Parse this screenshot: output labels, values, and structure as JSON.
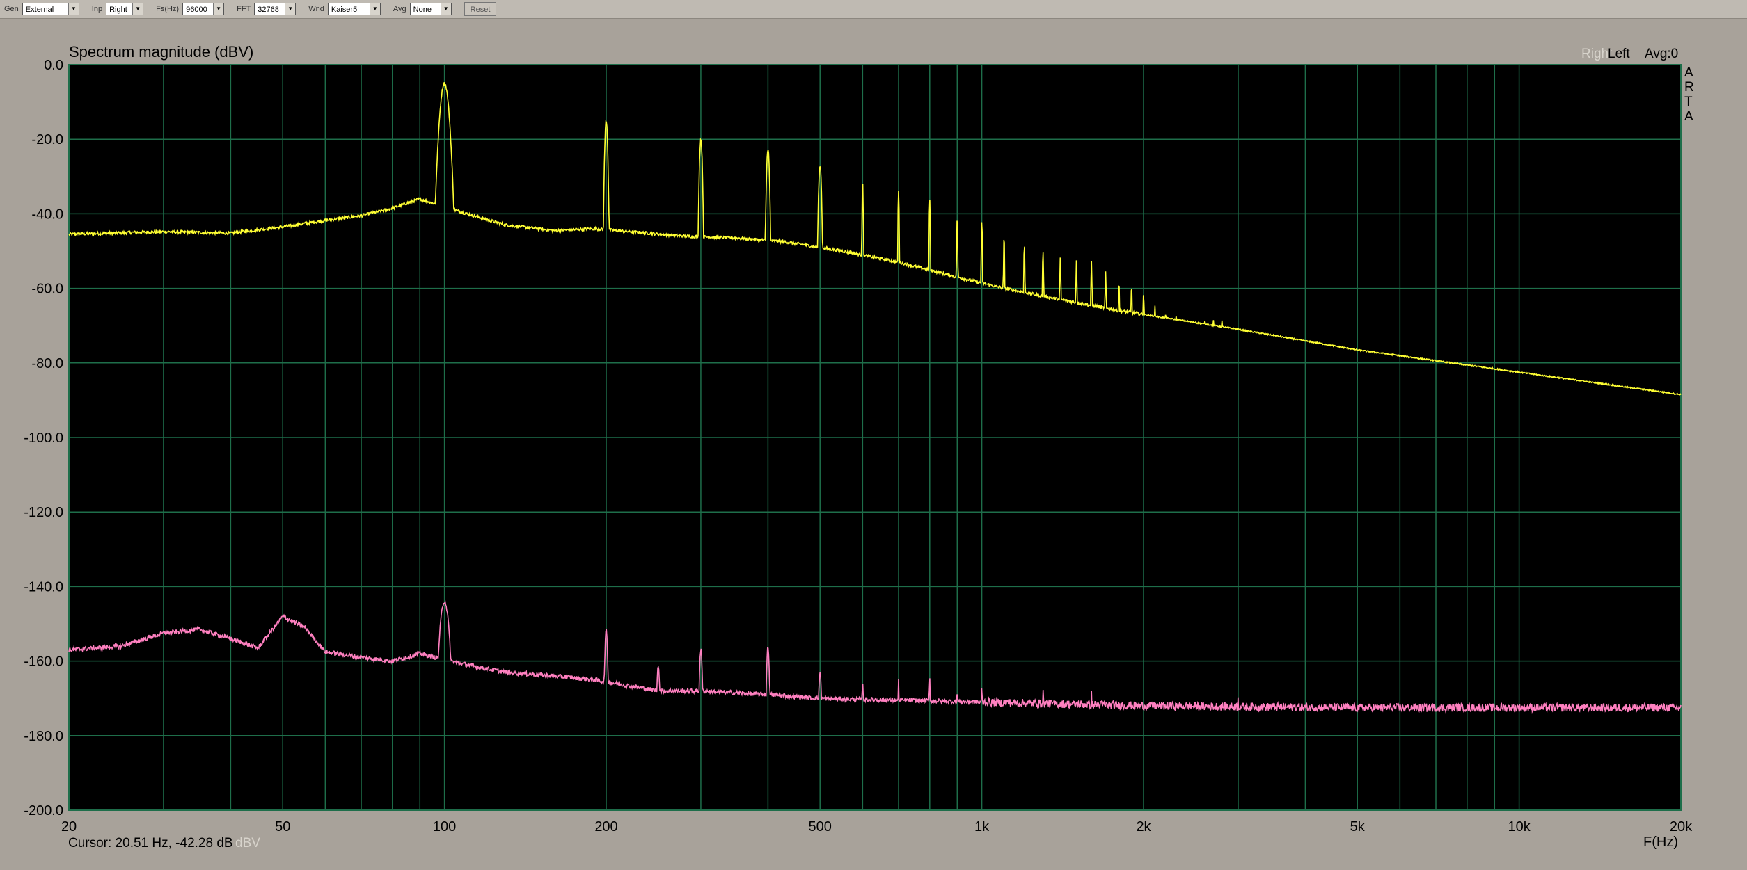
{
  "toolbar": {
    "gen_label": "Gen",
    "gen_value": "External",
    "inp_label": "Inp",
    "inp_value": "Right",
    "fs_label": "Fs(Hz)",
    "fs_value": "96000",
    "fft_label": "FFT",
    "fft_value": "32768",
    "wnd_label": "Wnd",
    "wnd_value": "Kaiser5",
    "avg_label": "Avg",
    "avg_value": "None",
    "reset_label": "Reset"
  },
  "status": {
    "channel_text": "Left",
    "avg_text": "Avg:0",
    "faded_text": "Right",
    "cursor_text": "Cursor: 20.51 Hz, -42.28 dB",
    "cursor_faded": "dBV",
    "arta_letters": [
      "A",
      "R",
      "T",
      "A"
    ]
  },
  "chart_data": {
    "type": "line",
    "title": "Spectrum magnitude (dBV)",
    "xlabel": "F(Hz)",
    "ylabel": "",
    "xscale": "log",
    "xlim": [
      20,
      20000
    ],
    "ylim": [
      -200,
      0
    ],
    "grid": true,
    "y_ticks": [
      0,
      -20,
      -40,
      -60,
      -80,
      -100,
      -120,
      -140,
      -160,
      -180,
      -200
    ],
    "y_tick_labels": [
      "0.0",
      "-20.0",
      "-40.0",
      "-60.0",
      "-80.0",
      "-100.0",
      "-120.0",
      "-140.0",
      "-160.0",
      "-180.0",
      "-200.0"
    ],
    "x_ticks": [
      20,
      50,
      100,
      200,
      500,
      1000,
      2000,
      5000,
      10000,
      20000
    ],
    "x_tick_labels": [
      "20",
      "50",
      "100",
      "200",
      "500",
      "1k",
      "2k",
      "5k",
      "10k",
      "20k"
    ],
    "x_minor_grid": [
      30,
      40,
      60,
      70,
      80,
      90,
      300,
      400,
      600,
      700,
      800,
      900,
      3000,
      4000,
      6000,
      7000,
      8000,
      9000
    ],
    "colors": {
      "background": "#000000",
      "grid": "#1e6e4a",
      "series1": "#ffff33",
      "series2": "#ff80c0"
    },
    "series": [
      {
        "color": "#ffff33",
        "baseline": [
          [
            20,
            -45.5
          ],
          [
            30,
            -44.8
          ],
          [
            40,
            -45.2
          ],
          [
            50,
            -43.5
          ],
          [
            60,
            -41.8
          ],
          [
            70,
            -40.5
          ],
          [
            80,
            -38.5
          ],
          [
            90,
            -36
          ],
          [
            110,
            -40
          ],
          [
            130,
            -43
          ],
          [
            160,
            -44.5
          ],
          [
            190,
            -44
          ],
          [
            230,
            -45
          ],
          [
            280,
            -46
          ],
          [
            350,
            -46.5
          ],
          [
            430,
            -47.5
          ],
          [
            550,
            -50
          ],
          [
            700,
            -53
          ],
          [
            900,
            -57
          ],
          [
            1100,
            -60
          ],
          [
            1400,
            -63
          ],
          [
            1800,
            -66
          ],
          [
            2000,
            -67
          ],
          [
            3000,
            -71
          ],
          [
            5000,
            -76.5
          ],
          [
            10000,
            -82.5
          ],
          [
            20000,
            -88.5
          ]
        ],
        "peaks": [
          [
            100,
            -5
          ],
          [
            200,
            -15
          ],
          [
            300,
            -20
          ],
          [
            400,
            -22.5
          ],
          [
            500,
            -27
          ],
          [
            600,
            -31
          ],
          [
            700,
            -33.5
          ],
          [
            800,
            -36
          ],
          [
            900,
            -41
          ],
          [
            1000,
            -42
          ],
          [
            1100,
            -46
          ],
          [
            1200,
            -48.5
          ],
          [
            1300,
            -50
          ],
          [
            1400,
            -52
          ],
          [
            1500,
            -52.5
          ],
          [
            1600,
            -53
          ],
          [
            1700,
            -55.5
          ],
          [
            1800,
            -58
          ],
          [
            1900,
            -59
          ],
          [
            2000,
            -61
          ],
          [
            2100,
            -64.5
          ],
          [
            2200,
            -66
          ],
          [
            2300,
            -67.5
          ],
          [
            2400,
            -68.5
          ],
          [
            2500,
            -68.5
          ],
          [
            2600,
            -68.5
          ],
          [
            2700,
            -68
          ],
          [
            2800,
            -68.5
          ],
          [
            2900,
            -70
          ],
          [
            3000,
            -70.5
          ]
        ]
      },
      {
        "color": "#ff80c0",
        "baseline": [
          [
            20,
            -157
          ],
          [
            25,
            -156
          ],
          [
            30,
            -152.5
          ],
          [
            35,
            -151.5
          ],
          [
            40,
            -154
          ],
          [
            45,
            -156.5
          ],
          [
            50,
            -148
          ],
          [
            55,
            -151
          ],
          [
            60,
            -157.5
          ],
          [
            70,
            -159
          ],
          [
            80,
            -160
          ],
          [
            90,
            -158
          ],
          [
            110,
            -161
          ],
          [
            130,
            -163
          ],
          [
            160,
            -164
          ],
          [
            190,
            -165
          ],
          [
            250,
            -168
          ],
          [
            300,
            -168
          ],
          [
            400,
            -169
          ],
          [
            500,
            -170
          ],
          [
            700,
            -170.5
          ],
          [
            1000,
            -171
          ],
          [
            2000,
            -172
          ],
          [
            5000,
            -172.5
          ],
          [
            20000,
            -172.5
          ]
        ],
        "peaks": [
          [
            100,
            -144
          ],
          [
            200,
            -152
          ],
          [
            250,
            -161
          ],
          [
            300,
            -157
          ],
          [
            400,
            -156.5
          ],
          [
            500,
            -163
          ],
          [
            600,
            -165
          ],
          [
            700,
            -165
          ],
          [
            800,
            -164
          ],
          [
            900,
            -168
          ],
          [
            1000,
            -167
          ],
          [
            1300,
            -168
          ],
          [
            1600,
            -169
          ],
          [
            3000,
            -170
          ]
        ]
      }
    ]
  }
}
